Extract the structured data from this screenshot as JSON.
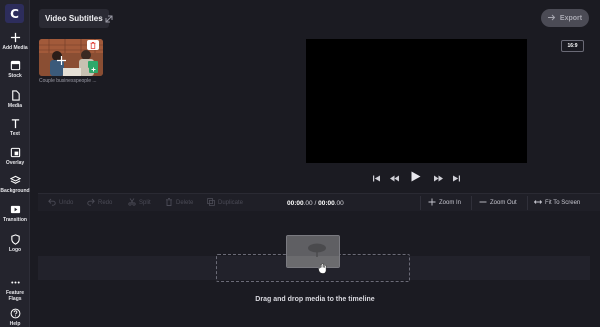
{
  "app": {
    "logo_letter": "C"
  },
  "sidebar": {
    "items": [
      {
        "label": "Add Media",
        "icon": "plus-icon"
      },
      {
        "label": "Stock",
        "icon": "stock-icon"
      },
      {
        "label": "Media",
        "icon": "file-icon"
      },
      {
        "label": "Text",
        "icon": "text-icon"
      },
      {
        "label": "Overlay",
        "icon": "overlay-icon"
      },
      {
        "label": "Background",
        "icon": "layers-icon"
      },
      {
        "label": "Transition",
        "icon": "transition-icon"
      },
      {
        "label": "Logo",
        "icon": "shield-icon"
      },
      {
        "label": "Feature Flags",
        "icon": "more-icon"
      },
      {
        "label": "Help",
        "icon": "help-icon"
      }
    ]
  },
  "header": {
    "title": "Video Subtitles",
    "export_label": "Export"
  },
  "library": {
    "media_caption": "Couple businesspeople ..."
  },
  "preview": {
    "aspect_ratio": "16:9"
  },
  "timeline": {
    "toolbar": {
      "undo": "Undo",
      "redo": "Redo",
      "split": "Split",
      "delete": "Delete",
      "duplicate": "Duplicate",
      "zoom_in": "Zoom In",
      "zoom_out": "Zoom Out",
      "fit": "Fit To Screen"
    },
    "current_time": "00:00",
    "current_frac": ".00",
    "time_sep": " / ",
    "total_time": "00:00",
    "total_frac": ".00",
    "hint": "Drag and drop media to the timeline"
  }
}
